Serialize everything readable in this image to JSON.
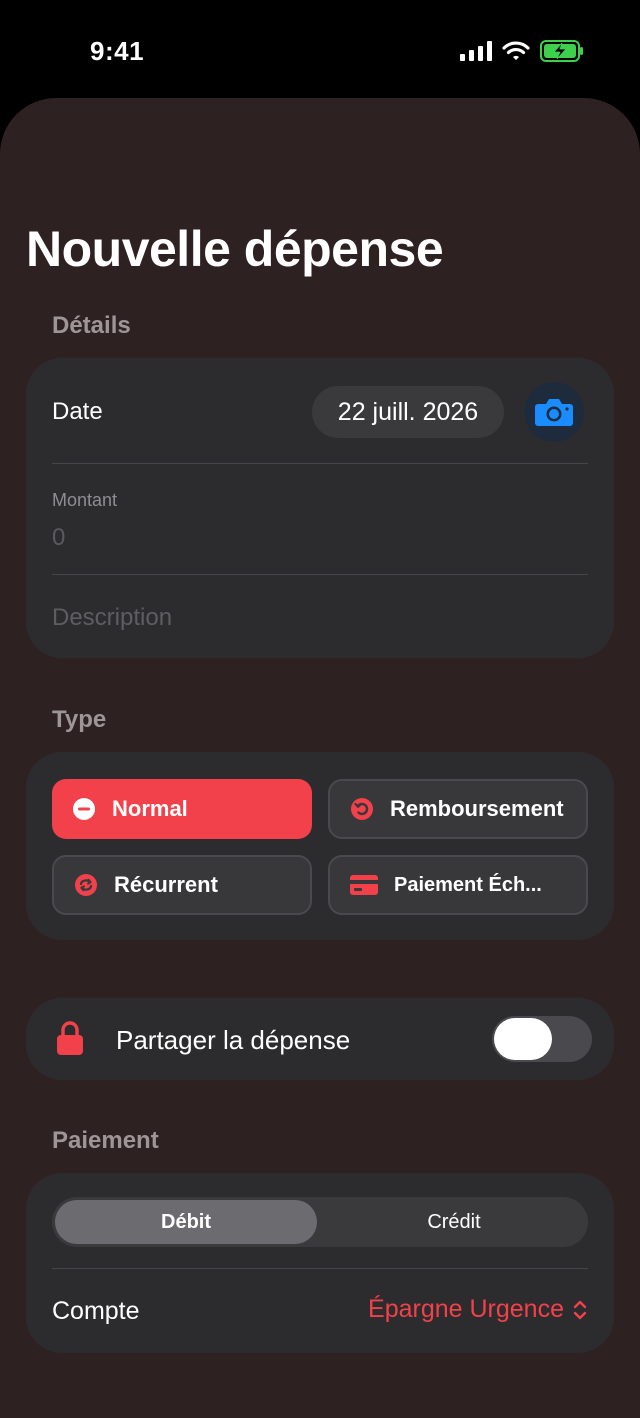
{
  "status_bar": {
    "time": "9:41"
  },
  "title": "Nouvelle dépense",
  "details": {
    "section_label": "Détails",
    "date_label": "Date",
    "date_value": "22 juill. 2026",
    "amount_label": "Montant",
    "amount_placeholder": "0",
    "description_placeholder": "Description"
  },
  "type": {
    "section_label": "Type",
    "options": [
      {
        "label": "Normal",
        "icon": "minus-circle-icon",
        "selected": true
      },
      {
        "label": "Remboursement",
        "icon": "refund-icon",
        "selected": false
      },
      {
        "label": "Récurrent",
        "icon": "recurring-icon",
        "selected": false
      },
      {
        "label": "Paiement Éch...",
        "icon": "credit-card-icon",
        "selected": false
      }
    ]
  },
  "share": {
    "label": "Partager la dépense",
    "icon": "lock-icon",
    "enabled": false
  },
  "payment": {
    "section_label": "Paiement",
    "segments": [
      "Débit",
      "Crédit"
    ],
    "selected_segment": "Débit",
    "account_label": "Compte",
    "account_value": "Épargne Urgence"
  },
  "colors": {
    "accent": "#f2414a",
    "sheet_background": "#2e2122",
    "card_background": "#2c2c2e",
    "camera_blue": "#1a8cff"
  }
}
